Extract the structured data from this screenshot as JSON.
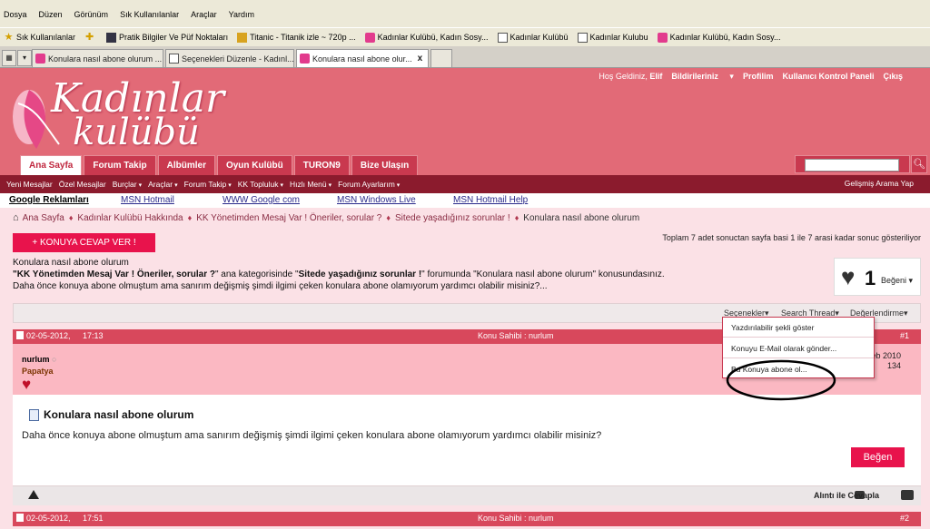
{
  "browser": {
    "menu": [
      "Dosya",
      "Düzen",
      "Görünüm",
      "Sık Kullanılanlar",
      "Araçlar",
      "Yardım"
    ],
    "bookmarks": [
      {
        "label": "Sık Kullanılanlar",
        "icon": "star-icon"
      },
      {
        "label": "",
        "icon": "add-favorite-icon"
      },
      {
        "label": "Pratik Bilgiler Ve Püf Noktaları",
        "icon": "site-icon"
      },
      {
        "label": "Titanic - Titanik izle ~ 720p ...",
        "icon": "video-icon"
      },
      {
        "label": "Kadınlar Kulübü, Kadın Sosy...",
        "icon": "pink-site-icon"
      },
      {
        "label": "Kadınlar Kulübü",
        "icon": "page-icon"
      },
      {
        "label": "Kadınlar Kulubu",
        "icon": "page-icon"
      },
      {
        "label": "Kadınlar Kulübü, Kadın Sosy...",
        "icon": "pink-site-icon"
      }
    ],
    "tabs": [
      {
        "label": "Konulara nasıl abone olurum ...",
        "active": false
      },
      {
        "label": "Seçenekleri Düzenle - Kadınl...",
        "active": false
      },
      {
        "label": "Konulara nasıl abone olur...",
        "active": true
      }
    ],
    "tab_close": "x"
  },
  "site": {
    "logo_line1": "Kadınlar",
    "logo_line2": "kulübü",
    "top_links": {
      "welcome": "Hoş Geldiniz,",
      "user": "Elif",
      "notifications": "Bildirileriniz",
      "profile": "Profilim",
      "control_panel": "Kullanıcı Kontrol Paneli",
      "logout": "Çıkış"
    },
    "nav_tabs": [
      "Ana Sayfa",
      "Forum Takip",
      "Albümler",
      "Oyun Kulübü",
      "TURON9",
      "Bize Ulaşın"
    ],
    "sub_nav": [
      "Yeni Mesajlar",
      "Özel Mesajlar",
      "Burçlar",
      "Araçlar",
      "Forum Takip",
      "KK Topluluk",
      "Hızlı Menü",
      "Forum Ayarlarım"
    ],
    "advanced_search": "Gelişmiş Arama Yap",
    "ads": {
      "title": "Google Reklamları",
      "links": [
        "MSN Hotmail",
        "WWW Google com",
        "MSN Windows Live",
        "MSN Hotmail Help"
      ]
    }
  },
  "breadcrumb": [
    "Ana Sayfa",
    "Kadınlar Kulübü Hakkında",
    "KK Yönetimden Mesaj Var ! Öneriler, sorular ?",
    "Sitede yaşadığınız sorunlar !",
    "Konulara nasıl abone olurum"
  ],
  "thread": {
    "reply_button": "+ KONUYA CEVAP VER !",
    "paging": "Toplam 7 adet sonuctan sayfa basi 1 ile 7 arasi kadar sonuc gösteriliyor",
    "title_line": "Konulara nasıl abone olurum",
    "desc_q1": "\"",
    "desc_category": "KK Yönetimden Mesaj Var ! Öneriler, sorular ?",
    "desc_mid": "\" ana kategorisinde \"",
    "desc_forum": "Sitede yaşadığınız sorunlar !",
    "desc_end": "\" forumunda \"Konulara nasıl abone olurum\" konusundasınız.",
    "desc_line3": "Daha önce konuya abone olmuştum ama sanırım değişmiş şimdi ilgimi çeken konulara abone olamıyorum yardımcı olabilir misiniz?...",
    "like_count": "1",
    "like_label": "Beğeni",
    "tools": {
      "options": "Seçenekler",
      "search": "Search Thread",
      "rating": "Değerlendirme"
    },
    "options_menu": [
      "Yazdırılabilir şekli göster",
      "Konuyu E-Mail olarak gönder...",
      "Bu Konuya abone ol..."
    ]
  },
  "posts": [
    {
      "date": "02-05-2012,",
      "time": "17:13",
      "owner": "Konu Sahibi : nurlum",
      "number": "#1",
      "username": "nurlum",
      "user_title": "Papatya",
      "join_date": "Feb 2010",
      "post_count": "134",
      "title": "Konulara nasıl abone olurum",
      "text": "Daha önce konuya abone olmuştum ama sanırım değişmiş şimdi ilgimi çeken konulara abone olamıyorum yardımcı olabilir misiniz?",
      "like_button": "Beğen",
      "quote_reply": "Alıntı ile Cevapla"
    },
    {
      "date": "02-05-2012,",
      "time": "17:51",
      "owner": "Konu Sahibi : nurlum",
      "number": "#2"
    }
  ],
  "colors": {
    "brand_pink": "#e26a77",
    "dark_red": "#8b1b2d",
    "button_red": "#e8134c"
  }
}
